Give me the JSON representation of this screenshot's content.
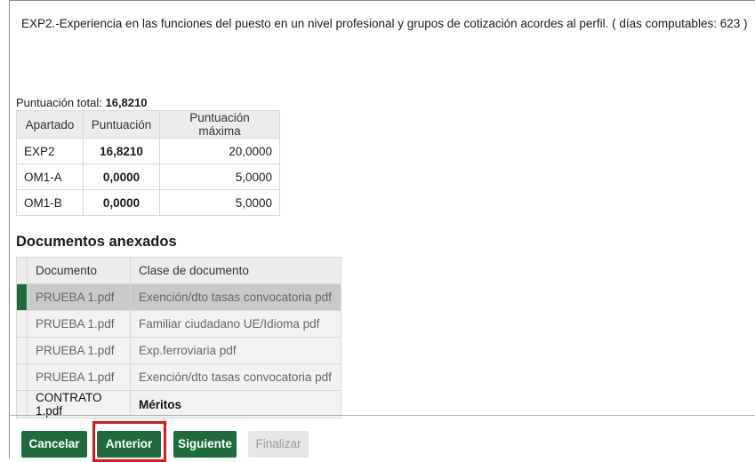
{
  "header": {
    "description": "EXP2.-Experiencia en las funciones del puesto en un nivel profesional y grupos de cotización acordes al perfil.  ( días computables: 623 )"
  },
  "scores": {
    "total_label": "Puntuación total:",
    "total_value": "16,8210",
    "columns": [
      "Apartado",
      "Puntuación",
      "Puntuación máxima"
    ],
    "rows": [
      {
        "apartado": "EXP2",
        "puntuacion": "16,8210",
        "maxima": "20,0000"
      },
      {
        "apartado": "OM1-A",
        "puntuacion": "0,0000",
        "maxima": "5,0000"
      },
      {
        "apartado": "OM1-B",
        "puntuacion": "0,0000",
        "maxima": "5,0000"
      }
    ]
  },
  "documents": {
    "title": "Documentos anexados",
    "columns": [
      "Documento",
      "Clase de documento"
    ],
    "rows": [
      {
        "documento": "PRUEBA 1.pdf",
        "clase": "Exención/dto tasas convocatoria pdf",
        "selected": true
      },
      {
        "documento": "PRUEBA 1.pdf",
        "clase": "Familiar ciudadano UE/Idioma pdf",
        "selected": false
      },
      {
        "documento": "PRUEBA 1.pdf",
        "clase": "Exp.ferroviaria pdf",
        "selected": false
      },
      {
        "documento": "PRUEBA 1.pdf",
        "clase": "Exención/dto tasas convocatoria pdf",
        "selected": false
      },
      {
        "documento": "CONTRATO 1.pdf",
        "clase": "Méritos",
        "selected": false
      }
    ]
  },
  "buttons": {
    "cancel": "Cancelar",
    "previous": "Anterior",
    "next": "Siguiente",
    "finish": "Finalizar"
  },
  "colors": {
    "primary": "#1e6b3c",
    "highlight": "#e0141f",
    "disabled": "#e6e6e6"
  }
}
